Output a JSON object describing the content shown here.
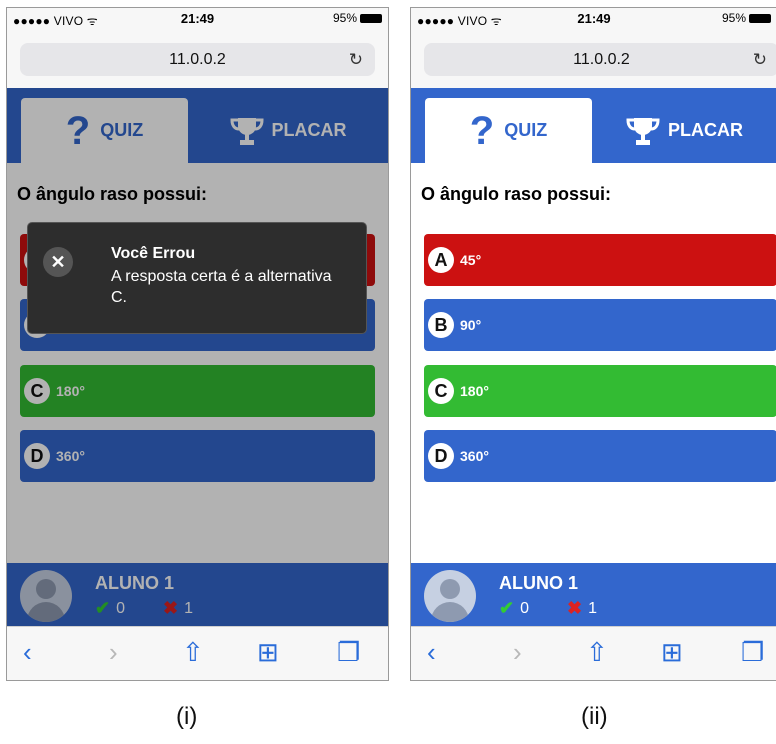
{
  "status": {
    "carrier": "●●●●● VIVO ᯤ",
    "time": "21:49",
    "battery": "95%"
  },
  "browser": {
    "url": "11.0.0.2",
    "reload_icon": "reload-icon"
  },
  "tabs": {
    "quiz": "QUIZ",
    "placar": "PLACAR",
    "quiz_icon": "?"
  },
  "question": "O ângulo raso possui:",
  "options": [
    {
      "letter": "A",
      "text": "45°",
      "color": "#cc1111"
    },
    {
      "letter": "B",
      "text": "90°",
      "color": "#3366cc"
    },
    {
      "letter": "C",
      "text": "180°",
      "color": "#33bb33"
    },
    {
      "letter": "D",
      "text": "360°",
      "color": "#3366cc"
    }
  ],
  "student": {
    "name": "ALUNO 1",
    "correct": "0",
    "wrong": "1"
  },
  "toast": {
    "title": "Você Errou",
    "message": "A resposta certa é a alternativa C."
  },
  "captions": {
    "left": "(i)",
    "right": "(ii)"
  },
  "colors": {
    "brand_blue": "#3366cc",
    "wrong_red": "#cc1111",
    "right_green": "#33bb33"
  }
}
